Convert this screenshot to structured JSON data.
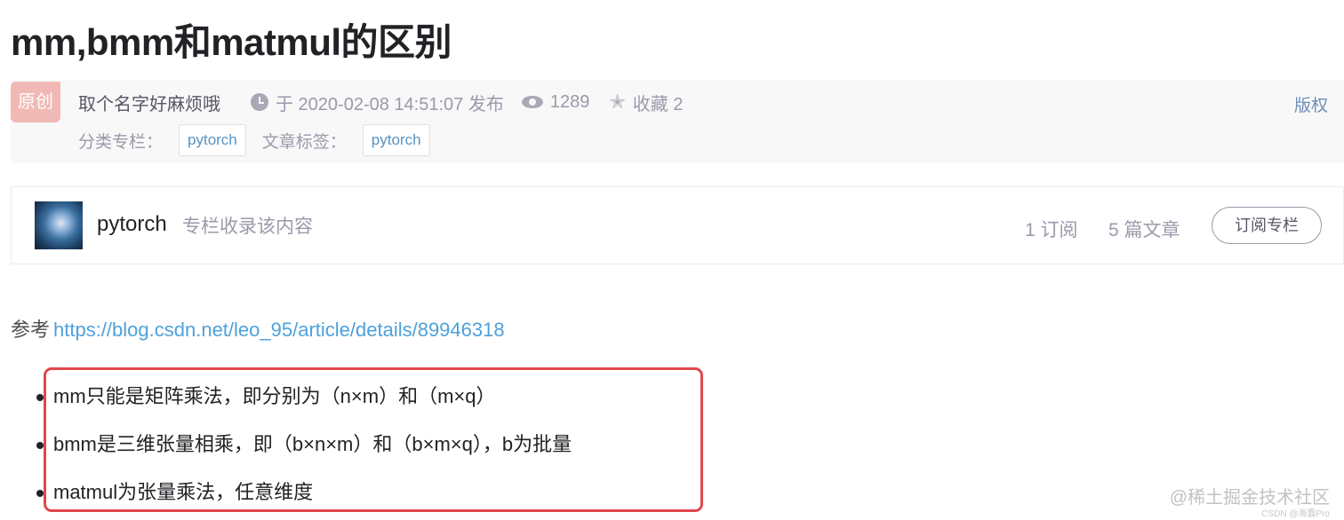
{
  "article": {
    "title": "mm,bmm和matmul的区别"
  },
  "meta": {
    "badge": "原创",
    "author": "取个名字好麻烦哦",
    "publish": "于 2020-02-08 14:51:07 发布",
    "views": "1289",
    "favorite": "收藏 2",
    "copyright": "版权",
    "category_label": "分类专栏：",
    "category_tag": "pytorch",
    "tags_label": "文章标签：",
    "article_tag": "pytorch"
  },
  "column": {
    "name": "pytorch",
    "desc": "专栏收录该内容",
    "subscribers": "1 订阅",
    "articles": "5 篇文章",
    "subscribe_button": "订阅专栏"
  },
  "content": {
    "ref_label": "参考",
    "ref_link": "https://blog.csdn.net/leo_95/article/details/89946318",
    "items": [
      "mm只能是矩阵乘法，即分别为（n×m）和（m×q）",
      "bmm是三维张量相乘，即（b×n×m）和（b×m×q），b为批量",
      "matmul为张量乘法，任意维度"
    ]
  },
  "watermark": {
    "text": "@稀土掘金技术社区",
    "sub": "CSDN @海蠢Pro"
  },
  "colors": {
    "highlight_border": "#e0474c",
    "link": "#4ea1db",
    "badge_bg": "#f0b9b5"
  }
}
